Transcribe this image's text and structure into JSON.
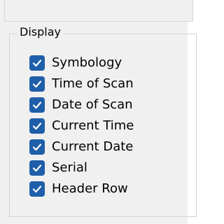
{
  "display_group": {
    "title": "Display",
    "options": [
      {
        "label": "Symbology",
        "checked": true
      },
      {
        "label": "Time of Scan",
        "checked": true
      },
      {
        "label": "Date of Scan",
        "checked": true
      },
      {
        "label": "Current Time",
        "checked": true
      },
      {
        "label": "Current Date",
        "checked": true
      },
      {
        "label": "Serial",
        "checked": true
      },
      {
        "label": "Header Row",
        "checked": true
      }
    ]
  },
  "colors": {
    "window_background": "#f0f0f0",
    "checkbox_fill": "#1f5fa9",
    "checkmark": "#ffffff",
    "border": "#d4d4d4"
  },
  "icons": {
    "checkbox": "check-icon"
  }
}
